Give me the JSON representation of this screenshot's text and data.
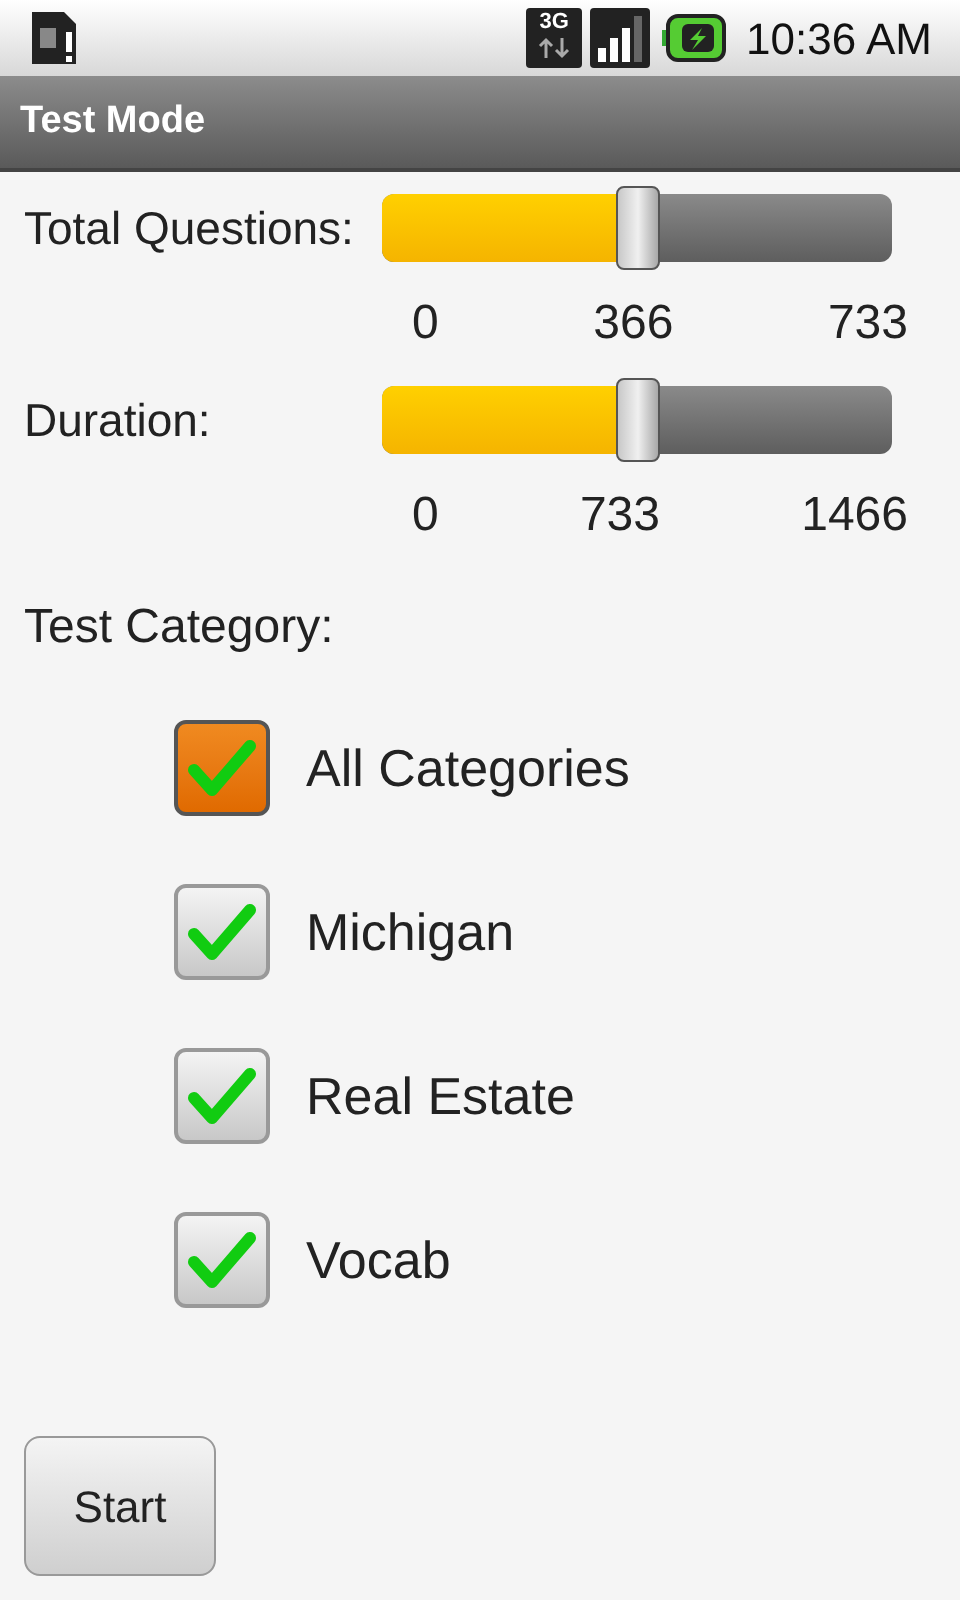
{
  "status_bar": {
    "time": "10:36 AM",
    "network": "3G"
  },
  "title_bar": {
    "title": "Test Mode"
  },
  "sliders": [
    {
      "label": "Total Questions:",
      "level": 0.5,
      "min": "0",
      "mid": "366",
      "max": "733"
    },
    {
      "label": "Duration:",
      "level": 0.5,
      "min": "0",
      "mid": "733",
      "max": "1466"
    }
  ],
  "category_label": "Test Category:",
  "categories": [
    {
      "label": "All Categories",
      "checked": true,
      "focused": true
    },
    {
      "label": "Michigan",
      "checked": true,
      "focused": false
    },
    {
      "label": "Real Estate",
      "checked": true,
      "focused": false
    },
    {
      "label": "Vocab",
      "checked": true,
      "focused": false
    }
  ],
  "start_button": {
    "label": "Start"
  }
}
